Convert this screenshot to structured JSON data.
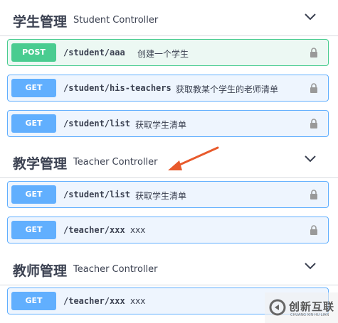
{
  "sections": [
    {
      "title": "学生管理",
      "description": "Student Controller",
      "operations": [
        {
          "method": "POST",
          "path": "/student/aaa",
          "summary": "创建一个学生"
        },
        {
          "method": "GET",
          "path": "/student/his-teachers",
          "summary": "获取教某个学生的老师清单"
        },
        {
          "method": "GET",
          "path": "/student/list",
          "summary": "获取学生清单"
        }
      ]
    },
    {
      "title": "教学管理",
      "description": "Teacher Controller",
      "operations": [
        {
          "method": "GET",
          "path": "/student/list",
          "summary": "获取学生清单"
        },
        {
          "method": "GET",
          "path": "/teacher/xxx",
          "summary": "xxx"
        }
      ]
    },
    {
      "title": "教师管理",
      "description": "Teacher Controller",
      "operations": [
        {
          "method": "GET",
          "path": "/teacher/xxx",
          "summary": "xxx"
        }
      ]
    }
  ],
  "icons": {
    "collapse": "chevron-down-icon",
    "lock": "lock-icon",
    "annotation": "arrow-annotation"
  },
  "colors": {
    "post": "#49cc90",
    "get": "#61affe",
    "arrow": "#e85a2c"
  },
  "watermark": {
    "text": "创新互联",
    "subtext": "CHUANG XIN HU LIAN"
  }
}
